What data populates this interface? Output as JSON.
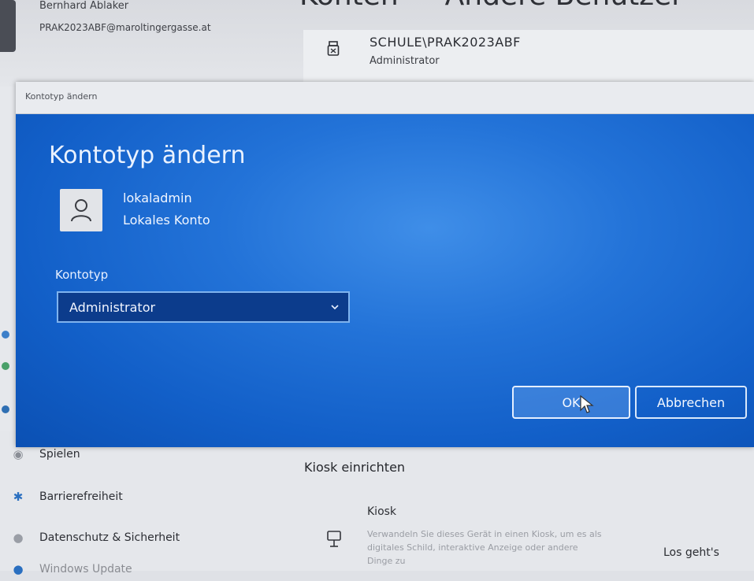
{
  "background": {
    "user_name": "Bernhard Ablaker",
    "user_email": "PRAK2023ABF@maroltingergasse.at",
    "heading": "Konten — Andere Benutzer",
    "account": {
      "name": "SCHULE\\PRAK2023ABF",
      "role": "Administrator",
      "icon": "usb-icon"
    },
    "nav_items": [
      {
        "label": "Spielen",
        "icon": "gamepad-icon"
      },
      {
        "label": "Barrierefreiheit",
        "icon": "accessibility-icon"
      },
      {
        "label": "Datenschutz & Sicherheit",
        "icon": "shield-icon"
      },
      {
        "label": "Windows Update",
        "icon": "update-icon"
      }
    ],
    "kiosk": {
      "section_title": "Kiosk einrichten",
      "name": "Kiosk",
      "description": "Verwandeln Sie dieses Gerät in einen Kiosk, um es als digitales Schild, interaktive Anzeige oder andere Dinge zu",
      "action": "Los geht's",
      "icon": "kiosk-icon"
    }
  },
  "dialog": {
    "title_bar": "Kontotyp ändern",
    "heading": "Kontotyp ändern",
    "user": {
      "name": "lokaladmin",
      "type": "Lokales Konto",
      "icon": "person-icon"
    },
    "field_label": "Kontotyp",
    "selected_type": "Administrator",
    "ok_label": "OK",
    "cancel_label": "Abbrechen"
  },
  "colors": {
    "dialog_blue": "#1e6fd6",
    "select_bg": "#0c3c8c",
    "select_border": "#7fb3ee"
  }
}
